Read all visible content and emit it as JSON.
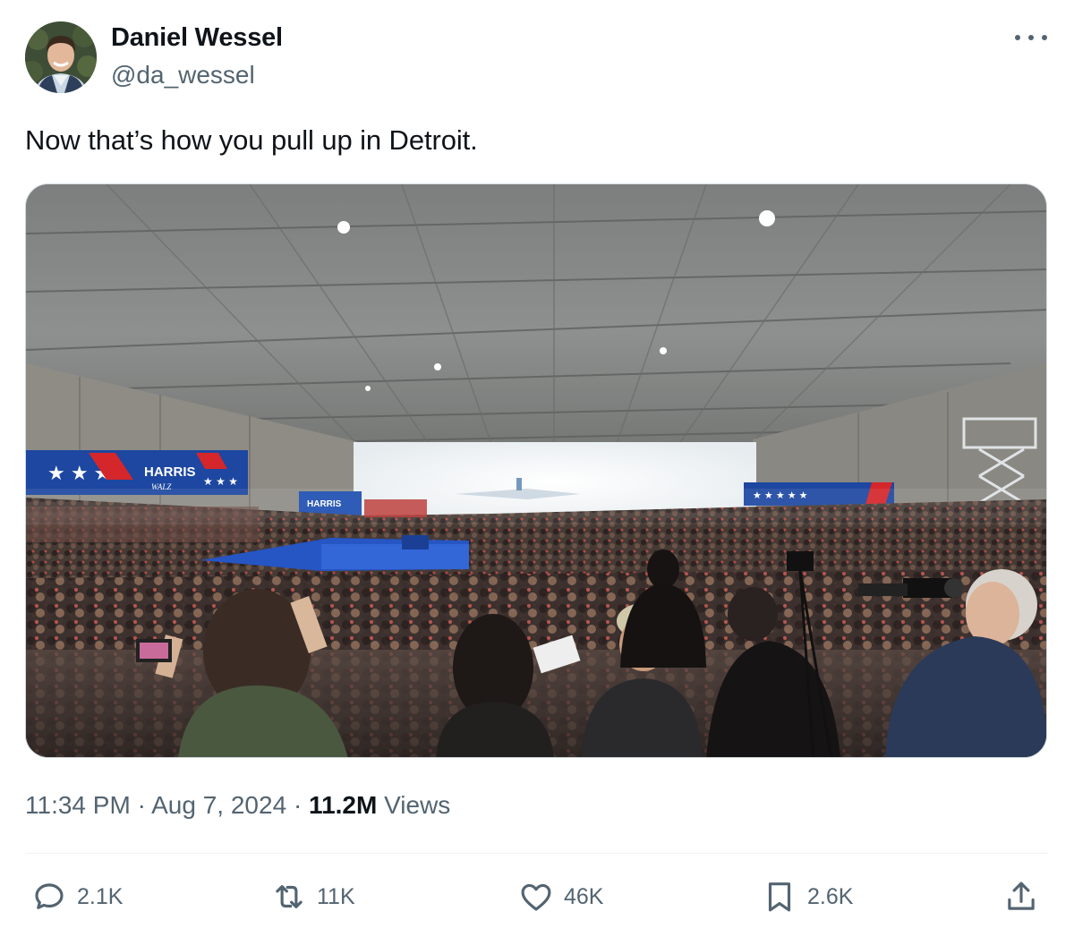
{
  "author": {
    "name": "Daniel Wessel",
    "handle": "@da_wessel",
    "avatar_icon": "profile-photo"
  },
  "tweet": {
    "text": "Now that’s how you pull up in Detroit."
  },
  "media": {
    "sign_main": "HARRIS",
    "sign_sub": "WALZ"
  },
  "meta": {
    "time": "11:34 PM",
    "separator": "·",
    "date": "Aug 7, 2024",
    "views_count": "11.2M",
    "views_label": "Views"
  },
  "actions": {
    "replies": "2.1K",
    "reposts": "11K",
    "likes": "46K",
    "bookmarks": "2.6K"
  },
  "colors": {
    "text": "#0f1419",
    "secondary": "#536471",
    "divider": "#eff3f4",
    "border": "#cfd9de"
  }
}
